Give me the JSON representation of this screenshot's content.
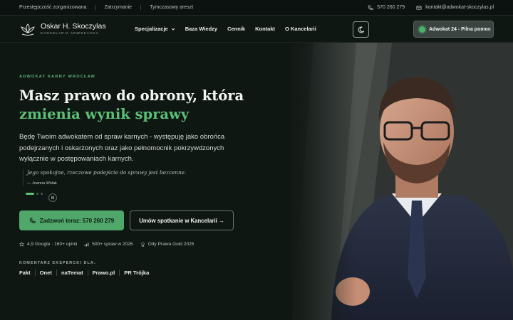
{
  "topbar": {
    "links": [
      "Przestępczość zorganizowana",
      "Zatrzymanie",
      "Tymczasowy areszt"
    ],
    "phone": "570 260 279",
    "email": "kontakt@adwokat-skoczylas.pl"
  },
  "nav": {
    "logo_name": "Oskar H. Skoczylas",
    "logo_sub": "KANCELARIA ADWOKACKA",
    "menu": [
      "Specjalizacje",
      "Baza Wiedzy",
      "Cennik",
      "Kontakt",
      "O Kancelarii"
    ],
    "cta_24": "Adwokat 24 - Pilna pomoc"
  },
  "hero": {
    "eyebrow": "ADWOKAT KARNY WROCŁAW",
    "headline_plain": "Masz prawo do obrony, która ",
    "headline_accent": "zmienia wynik sprawy",
    "lead": "Będę Twoim adwokatem od spraw karnych - występuję jako obrońca podejrzanych i oskarżonych oraz jako pełnomocnik pokrzywdzonych wyłącznie w postępowaniach karnych.",
    "quote": "Jego spokojne, rzeczowe podejście do sprawy jest bezcenne.",
    "quote_author": "— Joanna Wolak",
    "btn_call": "Zadzwoń teraz: 570 260 279",
    "btn_meet": "Umów spotkanie w Kancelarii →",
    "stats": [
      "4,9 Google · 160+ opinii",
      "500+ spraw w 2026",
      "Orły Prawa Gold 2025"
    ],
    "expert_label": "KOMENTARZ EKSPERCKI DLA:",
    "media": [
      "Fakt",
      "Onet",
      "naTemat",
      "Prawo.pl",
      "PR Trójka"
    ]
  },
  "colors": {
    "accent": "#5cbf77",
    "button_green": "#4fa76a",
    "background": "#0f1713"
  }
}
